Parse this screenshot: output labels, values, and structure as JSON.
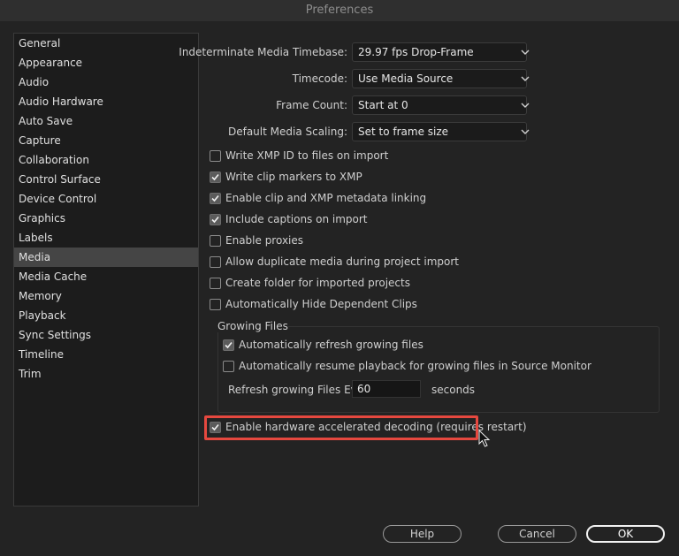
{
  "window": {
    "title": "Preferences"
  },
  "sidebar": {
    "items": [
      {
        "label": "General"
      },
      {
        "label": "Appearance"
      },
      {
        "label": "Audio"
      },
      {
        "label": "Audio Hardware"
      },
      {
        "label": "Auto Save"
      },
      {
        "label": "Capture"
      },
      {
        "label": "Collaboration"
      },
      {
        "label": "Control Surface"
      },
      {
        "label": "Device Control"
      },
      {
        "label": "Graphics"
      },
      {
        "label": "Labels"
      },
      {
        "label": "Media"
      },
      {
        "label": "Media Cache"
      },
      {
        "label": "Memory"
      },
      {
        "label": "Playback"
      },
      {
        "label": "Sync Settings"
      },
      {
        "label": "Timeline"
      },
      {
        "label": "Trim"
      }
    ],
    "selected": "Media"
  },
  "fields": [
    {
      "label": "Indeterminate Media Timebase:",
      "value": "29.97 fps Drop-Frame"
    },
    {
      "label": "Timecode:",
      "value": "Use Media Source"
    },
    {
      "label": "Frame Count:",
      "value": "Start at 0"
    },
    {
      "label": "Default Media Scaling:",
      "value": "Set to frame size"
    }
  ],
  "checkboxes": [
    {
      "label": "Write XMP ID to files on import",
      "checked": false
    },
    {
      "label": "Write clip markers to XMP",
      "checked": true
    },
    {
      "label": "Enable clip and XMP metadata linking",
      "checked": true
    },
    {
      "label": "Include captions on import",
      "checked": true
    },
    {
      "label": "Enable proxies",
      "checked": false
    },
    {
      "label": "Allow duplicate media during project import",
      "checked": false
    },
    {
      "label": "Create folder for imported projects",
      "checked": false
    },
    {
      "label": "Automatically Hide Dependent Clips",
      "checked": false
    }
  ],
  "growing_files": {
    "title": "Growing Files",
    "checkboxes": [
      {
        "label": "Automatically refresh growing files",
        "checked": true
      },
      {
        "label": "Automatically resume playback for growing files in Source Monitor",
        "checked": false
      }
    ],
    "refresh_label": "Refresh growing Files Every",
    "refresh_value": "60",
    "refresh_unit": "seconds"
  },
  "hardware_decoding": {
    "label": "Enable hardware accelerated decoding (requires restart)",
    "checked": true
  },
  "buttons": {
    "help": "Help",
    "cancel": "Cancel",
    "ok": "OK"
  },
  "colors": {
    "highlight": "#e5483f",
    "selected_bg": "#454545"
  }
}
